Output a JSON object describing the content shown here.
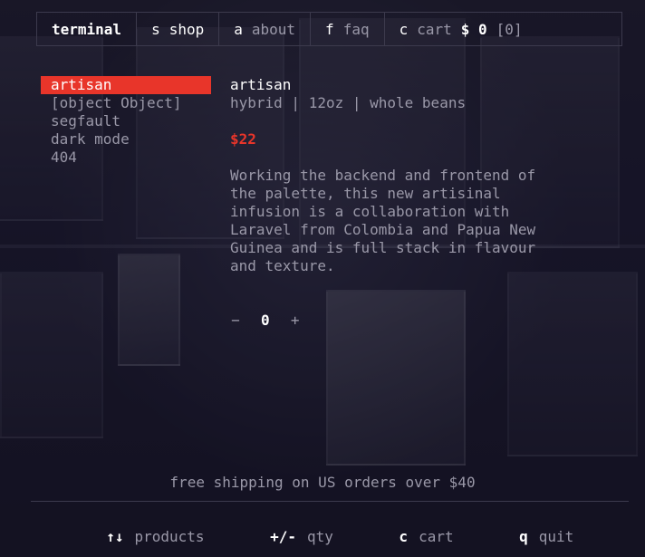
{
  "nav": {
    "items": [
      {
        "key": "",
        "label": "terminal"
      },
      {
        "key": "s",
        "label": "shop"
      },
      {
        "key": "a",
        "label": "about"
      },
      {
        "key": "f",
        "label": "faq"
      },
      {
        "key": "c",
        "label": "cart"
      }
    ],
    "cart_total": "$ 0",
    "cart_count": "[0]"
  },
  "sidebar": {
    "items": [
      {
        "label": "artisan",
        "selected": true
      },
      {
        "label": "[object Object]"
      },
      {
        "label": "segfault"
      },
      {
        "label": "dark mode"
      },
      {
        "label": "404"
      }
    ]
  },
  "product": {
    "name": "artisan",
    "meta": "hybrid | 12oz | whole beans",
    "price": "$22",
    "description": "Working the backend and frontend of\nthe palette, this new artisinal\ninfusion is a collaboration with\nLaravel from Colombia and Papua New\nGuinea and is full stack in flavour\nand texture.",
    "qty_minus": "−",
    "qty_value": "0",
    "qty_plus": "+"
  },
  "footer": {
    "shipping": "free shipping on US orders over $40",
    "hints": [
      {
        "key": "↑↓",
        "label": "products"
      },
      {
        "key": "+/-",
        "label": "qty"
      },
      {
        "key": "c",
        "label": "cart"
      },
      {
        "key": "q",
        "label": "quit"
      }
    ]
  },
  "colors": {
    "accent": "#e8352a",
    "background": "#14121f",
    "muted_text": "#9a98a8",
    "text": "#ffffff"
  }
}
